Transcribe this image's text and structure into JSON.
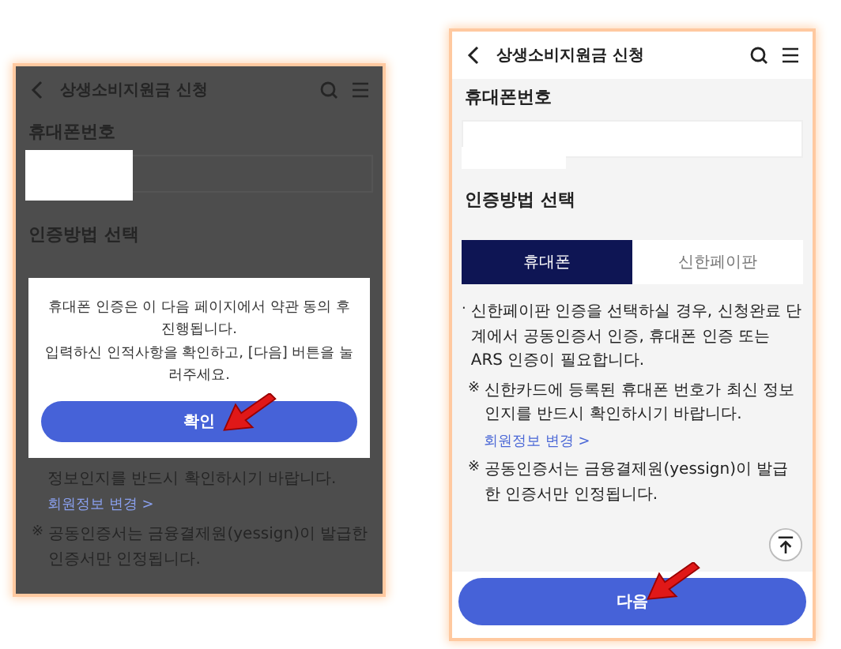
{
  "screens": [
    {
      "dimmed": true,
      "title": "상생소비지원금 신청",
      "phone_label": "휴대폰번호",
      "method_label": "인증방법 선택",
      "dialog": {
        "message": "휴대폰 인증은 이 다음 페이지에서 약관 동의 후 진행됩니다.\n입력하신 인적사항을 확인하고, [다음] 버튼을 눌러주세요.",
        "button": "확인"
      },
      "notes": [
        {
          "kind": "plain",
          "text": "정보인지를 반드시 확인하시기 바랍니다."
        },
        {
          "kind": "link",
          "text": "회원정보 변경",
          "icon": ">"
        },
        {
          "kind": "asterisk",
          "mark": "※",
          "text": "공동인증서는 금융결제원(yessign)이 발급한 인증서만 인정됩니다."
        }
      ]
    },
    {
      "dimmed": false,
      "title": "상생소비지원금 신청",
      "phone_label": "휴대폰번호",
      "method_label": "인증방법 선택",
      "tabs": [
        {
          "label": "휴대폰",
          "selected": true
        },
        {
          "label": "신한페이판",
          "selected": false
        }
      ],
      "notes": [
        {
          "kind": "bullet",
          "mark": "·",
          "text": "신한페이판 인증을 선택하실 경우, 신청완료 단계에서 공동인증서 인증, 휴대폰 인증 또는 ARS 인증이 필요합니다."
        },
        {
          "kind": "asterisk",
          "mark": "※",
          "text": "신한카드에 등록된 휴대폰 번호가 최신 정보인지를 반드시 확인하시기 바랍니다."
        },
        {
          "kind": "link",
          "text": "회원정보 변경",
          "icon": ">"
        },
        {
          "kind": "asterisk",
          "mark": "※",
          "text": "공동인증서는 금융결제원(yessign)이 발급한 인증서만 인정됩니다."
        }
      ],
      "next_button": "다음"
    }
  ]
}
